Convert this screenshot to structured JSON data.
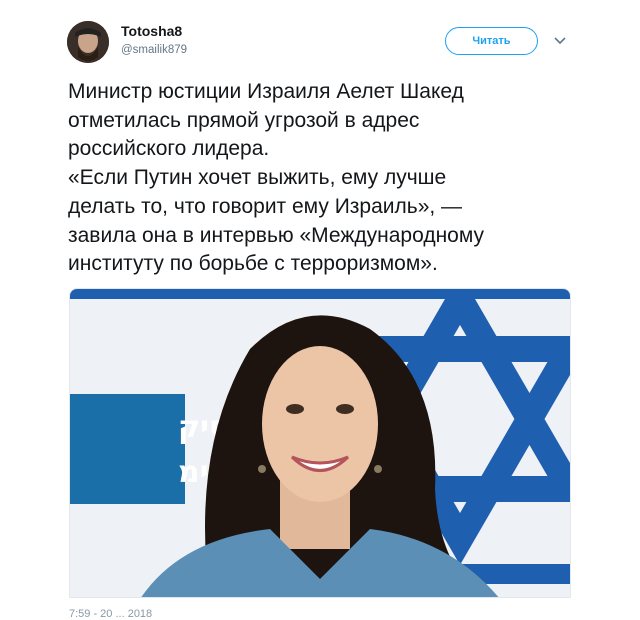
{
  "tweet": {
    "author": {
      "name": "Totosha8",
      "handle": "@smailik879"
    },
    "follow_label": "Читать",
    "text_lines": [
      "Министр юстиции Израиля Аелет Шакед",
      "отметилась прямой угрозой в адрес",
      "российского лидера.",
      "«Если Путин хочет выжить, ему лучше",
      "делать то, что говорит ему Израиль», —",
      "завила она в интервью «Международному",
      "институту по борьбе с терроризмом»."
    ],
    "media": {
      "sign_line1": "מפסיק",
      "sign_line2": "הימ"
    },
    "timestamp": "7:59 - 20 ... 2018"
  },
  "colors": {
    "accent": "#1da1f2",
    "flag_blue": "#1f5fb0",
    "sign_blue": "#1a6fa8"
  },
  "icons": {
    "menu": "chevron-down-icon"
  }
}
